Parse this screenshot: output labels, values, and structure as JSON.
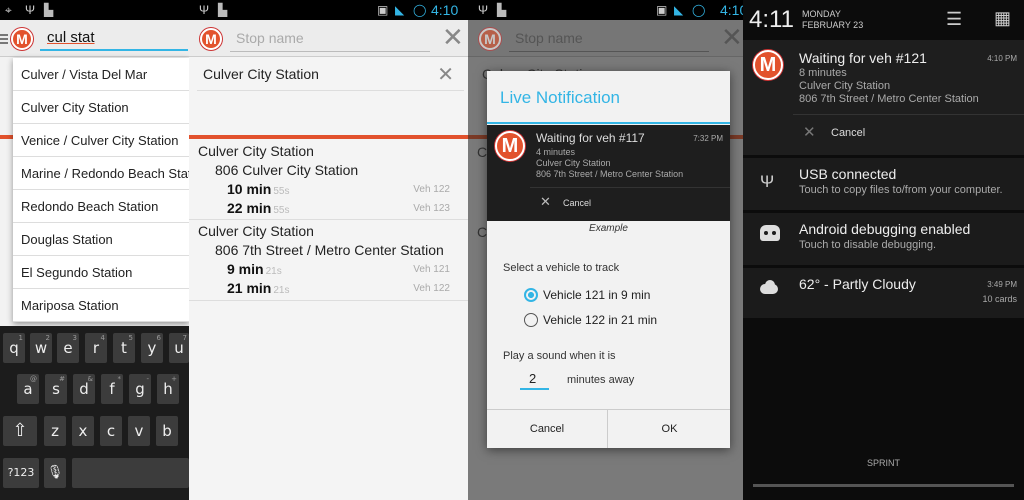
{
  "colors": {
    "accent": "#e2522d",
    "holo": "#33b5e5"
  },
  "panel1": {
    "search_value": "cul stat",
    "suggestions": [
      "Culver / Vista Del Mar",
      "Culver City Station",
      "Venice / Culver City Station",
      "Marine / Redondo Beach Station",
      "Redondo Beach Station",
      "Douglas Station",
      "El Segundo Station",
      "Mariposa Station"
    ],
    "keys": {
      "row1": [
        "q",
        "w",
        "e",
        "r",
        "t",
        "y",
        "u"
      ],
      "row1_alt": [
        "1",
        "2",
        "3",
        "4",
        "5",
        "6",
        "7"
      ],
      "row2": [
        "a",
        "s",
        "d",
        "f",
        "g",
        "h"
      ],
      "row2_alt": [
        "@",
        "#",
        "&",
        "*",
        "-",
        "+"
      ],
      "row3": [
        "z",
        "x",
        "c",
        "v",
        "b"
      ],
      "row3_alt": [
        "",
        "",
        "",
        "",
        ""
      ],
      "symbols": "?123"
    }
  },
  "status": {
    "time": "4:10"
  },
  "panel2": {
    "placeholder": "Stop name",
    "selected_stop": "Culver City Station",
    "groups": [
      {
        "stop": "Culver City Station",
        "dest": "806 Culver City Station",
        "times": [
          {
            "min": "10 min",
            "sec": "55s",
            "veh": "Veh 122"
          },
          {
            "min": "22 min",
            "sec": "55s",
            "veh": "Veh 123"
          }
        ]
      },
      {
        "stop": "Culver City Station",
        "dest": "806 7th Street / Metro Center Station",
        "times": [
          {
            "min": "9 min",
            "sec": "21s",
            "veh": "Veh 121"
          },
          {
            "min": "21 min",
            "sec": "21s",
            "veh": "Veh 122"
          }
        ]
      }
    ]
  },
  "panel3": {
    "placeholder": "Stop name",
    "bg_stop": "Culver City Station",
    "bg_letter": "C",
    "dialog": {
      "title": "Live Notification",
      "notif": {
        "title": "Waiting for veh #117",
        "time": "7:32 PM",
        "line1": "4 minutes",
        "line2": "Culver City Station",
        "line3": "806 7th Street / Metro Center Station",
        "cancel": "Cancel"
      },
      "example": "Example",
      "select_label": "Select a vehicle to track",
      "options": [
        "Vehicle 121 in 9 min",
        "Vehicle 122 in 21 min"
      ],
      "sound_label": "Play a sound when it is",
      "minutes_value": "2",
      "minutes_suffix": "minutes away",
      "cancel": "Cancel",
      "ok": "OK"
    }
  },
  "panel4": {
    "time": "4:11",
    "day": "MONDAY",
    "date": "FEBRUARY 23",
    "notifications": [
      {
        "title": "Waiting for veh #121",
        "time": "4:10 PM",
        "line1": "8 minutes",
        "line2": "Culver City Station",
        "line3": "806 7th Street / Metro Center Station",
        "cancel": "Cancel"
      },
      {
        "title": "USB connected",
        "text": "Touch to copy files to/from your computer.",
        "icon": "usb-icon"
      },
      {
        "title": "Android debugging enabled",
        "text": "Touch to disable debugging.",
        "icon": "android-icon"
      },
      {
        "title": "62° - Partly Cloudy",
        "time": "3:49 PM",
        "text": "10 cards",
        "icon": "cloud-icon"
      }
    ],
    "carrier": "SPRINT"
  }
}
